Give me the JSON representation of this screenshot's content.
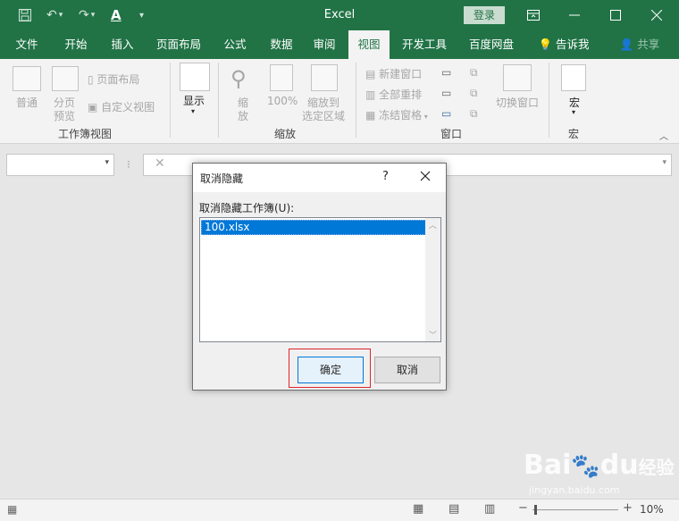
{
  "app": {
    "title": "Excel",
    "login_label": "登录"
  },
  "tabs": [
    "文件",
    "开始",
    "插入",
    "页面布局",
    "公式",
    "数据",
    "审阅",
    "视图",
    "开发工具",
    "百度网盘",
    "告诉我",
    "共享"
  ],
  "ribbon": {
    "workbook_view": {
      "group_label": "工作簿视图",
      "normal": "普通",
      "page_break_1": "分页",
      "page_break_2": "预览",
      "page_layout": "页面布局",
      "custom_view": "自定义视图"
    },
    "show": {
      "label": "显示"
    },
    "zoom": {
      "group_label": "缩放",
      "zoom_1": "缩",
      "zoom_2": "放",
      "zoom_100": "100%",
      "zoom_sel_1": "缩放到",
      "zoom_sel_2": "选定区域"
    },
    "window": {
      "group_label": "窗口",
      "new_window": "新建窗口",
      "arrange_all": "全部重排",
      "freeze_panes": "冻结窗格",
      "switch_windows": "切换窗口"
    },
    "macros": {
      "group_label": "宏",
      "macro": "宏"
    }
  },
  "dialog": {
    "title": "取消隐藏",
    "help": "?",
    "prompt": "取消隐藏工作簿(U):",
    "items": [
      "100.xlsx"
    ],
    "ok": "确定",
    "cancel": "取消"
  },
  "status": {
    "zoom": "10%"
  },
  "watermark": {
    "brand": "Bai",
    "brand2": "du",
    "site": "经验",
    "url": "jingyan.baidu.com"
  },
  "colors": {
    "excel_green": "#217346",
    "selection_blue": "#0078d7",
    "highlight_red": "#e0242c"
  }
}
